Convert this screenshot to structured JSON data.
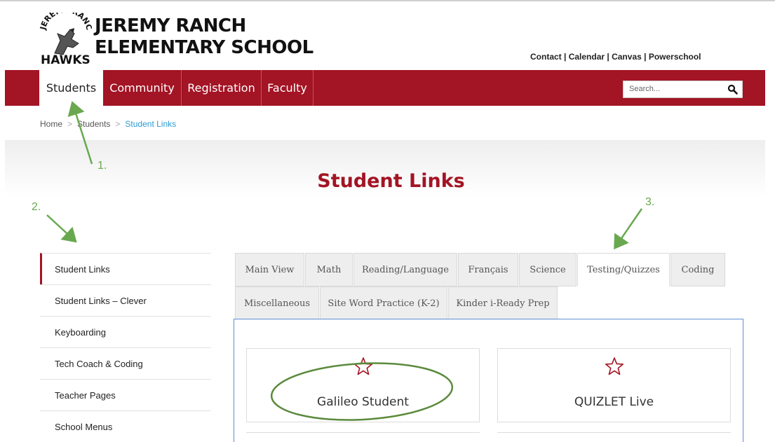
{
  "header": {
    "logo_text": "JEREMY RANCH HAWKS",
    "school_line1": "JEREMY RANCH",
    "school_line2": "ELEMENTARY SCHOOL",
    "util_links": [
      "Contact",
      "Calendar",
      "Canvas",
      "Powerschool"
    ],
    "util_sep": " | "
  },
  "nav": {
    "items": [
      {
        "label": "Students",
        "active": true
      },
      {
        "label": "Community",
        "active": false
      },
      {
        "label": "Registration",
        "active": false
      },
      {
        "label": "Faculty",
        "active": false
      }
    ],
    "search_placeholder": "Search...",
    "search_icon": "magnifier-icon"
  },
  "breadcrumb": {
    "items": [
      "Home",
      "Students",
      "Student Links"
    ],
    "separator": ">"
  },
  "page": {
    "title": "Student Links"
  },
  "sidebar": {
    "items": [
      {
        "label": "Student Links",
        "active": true
      },
      {
        "label": "Student Links – Clever"
      },
      {
        "label": "Keyboarding"
      },
      {
        "label": "Tech Coach & Coding"
      },
      {
        "label": "Teacher Pages"
      },
      {
        "label": "School Menus"
      }
    ]
  },
  "tabs": {
    "items": [
      {
        "label": "Main View"
      },
      {
        "label": "Math"
      },
      {
        "label": "Reading/Language"
      },
      {
        "label": "Français"
      },
      {
        "label": "Science"
      },
      {
        "label": "Testing/Quizzes",
        "active": true
      },
      {
        "label": "Coding"
      },
      {
        "label": "Miscellaneous"
      },
      {
        "label": "Site Word Practice (K-2)"
      },
      {
        "label": "Kinder i-Ready Prep"
      }
    ]
  },
  "cards": [
    {
      "title": "Galileo Student",
      "icon": "star-outline-icon"
    },
    {
      "title": "QUIZLET Live",
      "icon": "star-outline-icon"
    }
  ],
  "annotations": {
    "labels": [
      "1.",
      "2.",
      "3."
    ],
    "color": "#6aa84f"
  },
  "colors": {
    "brand_red": "#a31424",
    "link_blue": "#2b9bd2",
    "panel_border": "#5d8fd1"
  }
}
